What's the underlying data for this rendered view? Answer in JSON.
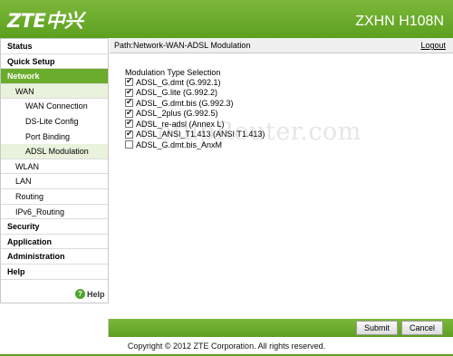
{
  "header": {
    "logo": "ZTE中兴",
    "model": "ZXHN H108N"
  },
  "sidebar": {
    "items": [
      {
        "label": "Status"
      },
      {
        "label": "Quick Setup"
      },
      {
        "label": "Network"
      },
      {
        "label": "WAN"
      },
      {
        "label": "WAN Connection"
      },
      {
        "label": "DS-Lite Config"
      },
      {
        "label": "Port Binding"
      },
      {
        "label": "ADSL Modulation"
      },
      {
        "label": "WLAN"
      },
      {
        "label": "LAN"
      },
      {
        "label": "Routing"
      },
      {
        "label": "IPv6_Routing"
      },
      {
        "label": "Security"
      },
      {
        "label": "Application"
      },
      {
        "label": "Administration"
      },
      {
        "label": "Help"
      }
    ],
    "help_label": "Help"
  },
  "content": {
    "path": "Path:Network-WAN-ADSL Modulation",
    "logout": "Logout",
    "section_title": "Modulation Type Selection",
    "options": [
      {
        "label": "ADSL_G.dmt (G.992.1)",
        "checked": true
      },
      {
        "label": "ADSL_G.lite (G.992.2)",
        "checked": true
      },
      {
        "label": "ADSL_G.dmt.bis (G.992.3)",
        "checked": true
      },
      {
        "label": "ADSL_2plus (G.992.5)",
        "checked": true
      },
      {
        "label": "ADSL_re-adsl (Annex L)",
        "checked": true
      },
      {
        "label": "ADSL_ANSI_T1.413 (ANSI T1.413)",
        "checked": true
      },
      {
        "label": "ADSL_G.dmt.bis_AnxM",
        "checked": false
      }
    ],
    "watermark": "SetupRouter.com"
  },
  "buttons": {
    "submit": "Submit",
    "cancel": "Cancel"
  },
  "footer": {
    "copyright": "Copyright © 2012 ZTE Corporation. All rights reserved."
  },
  "colors": {
    "brand_green": "#6aac2b",
    "header_green": "#5c9f1f"
  }
}
